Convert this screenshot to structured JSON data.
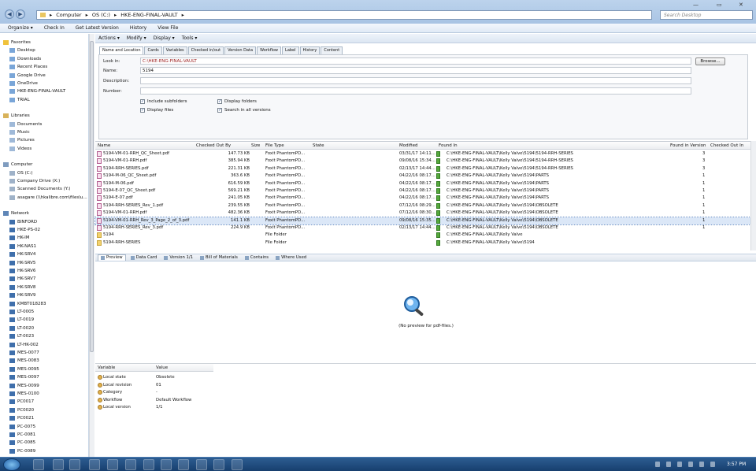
{
  "address": {
    "segments": [
      "Computer",
      "OS (C:)",
      "HKE-ENG-FINAL-VAULT"
    ],
    "search_placeholder": "Search Desktop"
  },
  "menubar": [
    "Organize ▾",
    "Check In",
    "Get Latest Version",
    "History",
    "View File"
  ],
  "sidebar": {
    "favorites_title": "Favorites",
    "favorites": [
      "Desktop",
      "Downloads",
      "Recent Places",
      "Google Drive",
      "OneDrive",
      "HKE-ENG-FINAL-VAULT",
      "TRIAL"
    ],
    "libraries_title": "Libraries",
    "libraries": [
      "Documents",
      "Music",
      "Pictures",
      "Videos"
    ],
    "computer_title": "Computer",
    "computer": [
      "OS (C:)",
      "Company Drive (X:)",
      "Scanned Documents (Y:)",
      "asagare (\\\\hkalibre.com\\files\\u..."
    ],
    "network_title": "Network",
    "network": [
      "BINFORD",
      "HKE-PS-02",
      "HK-IM",
      "HK-NAS1",
      "HK-SRV4",
      "HK-SRV5",
      "HK-SRV6",
      "HK-SRV7",
      "HK-SRV8",
      "HK-SRV9",
      "KMBT018283",
      "LT-0005",
      "LT-0019",
      "LT-0020",
      "LT-0023",
      "LT-HK-002",
      "MES-0077",
      "MES-0083",
      "MES-0095",
      "MES-0097",
      "MES-0099",
      "MES-0100",
      "PC0017",
      "PC0020",
      "PC0021",
      "PC-0075",
      "PC-0081",
      "PC-0085",
      "PC-0089"
    ]
  },
  "viewbar": [
    "Actions ▾",
    "Modify ▾",
    "Display ▾",
    "Tools ▾"
  ],
  "tabs": [
    "Name and Location",
    "Cards",
    "Variables",
    "Checked in/out",
    "Version Data",
    "Workflow",
    "Label",
    "History",
    "Content"
  ],
  "form": {
    "look_in_label": "Look in:",
    "look_in_value": "C:\\HKE-ENG-FINAL-VAULT",
    "name_label": "Name:",
    "name_value": "5194",
    "description_label": "Description:",
    "number_label": "Number:",
    "browse_label": "Browse...",
    "checkboxes": [
      "Include subfolders",
      "Display folders",
      "Display files",
      "Search in all versions"
    ]
  },
  "grid": {
    "headers": [
      "Name",
      "Checked Out By",
      "Size",
      "File Type",
      "State",
      "Modified",
      "Found In",
      "Found in Version",
      "Checked Out In"
    ],
    "rows": [
      {
        "name": "5194-VM-01-RRH_QC_Sheet.pdf",
        "size": "147.73 KB",
        "type": "Foxit PhantomPD...",
        "modified": "03/31/17 14:11...",
        "found": "C:\\HKE-ENG-FINAL-VAULT\\Kelly Valve\\5194\\5194-RRH-SERIES",
        "version": "3",
        "folder": false
      },
      {
        "name": "5194-VM-01-RRH.pdf",
        "size": "385.94 KB",
        "type": "Foxit PhantomPD...",
        "modified": "09/08/16 15:34...",
        "found": "C:\\HKE-ENG-FINAL-VAULT\\Kelly Valve\\5194\\5194-RRH-SERIES",
        "version": "3",
        "folder": false
      },
      {
        "name": "5194-RRH-SERIES.pdf",
        "size": "221.31 KB",
        "type": "Foxit PhantomPD...",
        "modified": "02/13/17 14:44...",
        "found": "C:\\HKE-ENG-FINAL-VAULT\\Kelly Valve\\5194\\5194-RRH-SERIES",
        "version": "3",
        "folder": false
      },
      {
        "name": "5194-M-06_QC_Sheet.pdf",
        "size": "363.6 KB",
        "type": "Foxit PhantomPD...",
        "modified": "04/22/16 08:17...",
        "found": "C:\\HKE-ENG-FINAL-VAULT\\Kelly Valve\\5194\\PARTS",
        "version": "1",
        "folder": false
      },
      {
        "name": "5194-M-06.pdf",
        "size": "616.59 KB",
        "type": "Foxit PhantomPD...",
        "modified": "04/22/16 08:17...",
        "found": "C:\\HKE-ENG-FINAL-VAULT\\Kelly Valve\\5194\\PARTS",
        "version": "1",
        "folder": false
      },
      {
        "name": "5194-E-07_QC_Sheet.pdf",
        "size": "569.21 KB",
        "type": "Foxit PhantomPD...",
        "modified": "04/22/16 08:17...",
        "found": "C:\\HKE-ENG-FINAL-VAULT\\Kelly Valve\\5194\\PARTS",
        "version": "1",
        "folder": false
      },
      {
        "name": "5194-E-07.pdf",
        "size": "241.05 KB",
        "type": "Foxit PhantomPD...",
        "modified": "04/22/16 08:17...",
        "found": "C:\\HKE-ENG-FINAL-VAULT\\Kelly Valve\\5194\\PARTS",
        "version": "1",
        "folder": false
      },
      {
        "name": "5194-RRH-SERIES_Rev_1.pdf",
        "size": "239.55 KB",
        "type": "Foxit PhantomPD...",
        "modified": "07/12/16 08:29...",
        "found": "C:\\HKE-ENG-FINAL-VAULT\\Kelly Valve\\5194\\OBSOLETE",
        "version": "1",
        "folder": false
      },
      {
        "name": "5194-VM-01-RRH.pdf",
        "size": "482.36 KB",
        "type": "Foxit PhantomPD...",
        "modified": "07/12/16 08:30...",
        "found": "C:\\HKE-ENG-FINAL-VAULT\\Kelly Valve\\5194\\OBSOLETE",
        "version": "1",
        "folder": false
      },
      {
        "name": "5194-VM-01-RRH_Rev_3_Page_2_of_3.pdf",
        "size": "141.1 KB",
        "type": "Foxit PhantomPD...",
        "modified": "09/08/16 15:35...",
        "found": "C:\\HKE-ENG-FINAL-VAULT\\Kelly Valve\\5194\\OBSOLETE",
        "version": "1",
        "folder": false,
        "selected": true
      },
      {
        "name": "5194-RRH-SERIES_Rev_3.pdf",
        "size": "224.9 KB",
        "type": "Foxit PhantomPD...",
        "modified": "02/13/17 14:44...",
        "found": "C:\\HKE-ENG-FINAL-VAULT\\Kelly Valve\\5194\\OBSOLETE",
        "version": "1",
        "folder": false
      },
      {
        "name": "5194",
        "size": "",
        "type": "File Folder",
        "modified": "",
        "found": "C:\\HKE-ENG-FINAL-VAULT\\Kelly Valve",
        "version": "",
        "folder": true
      },
      {
        "name": "5194-RRH-SERIES",
        "size": "",
        "type": "File Folder",
        "modified": "",
        "found": "C:\\HKE-ENG-FINAL-VAULT\\Kelly Valve\\5194",
        "version": "",
        "folder": true
      }
    ]
  },
  "preview_tabs": [
    "Preview",
    "Data Card",
    "Version 1/1",
    "Bill of Materials",
    "Contains",
    "Where Used"
  ],
  "preview_text": "(No preview for pdf-files.)",
  "props": {
    "headers": [
      "Variable",
      "Value"
    ],
    "rows": [
      {
        "var": "Local state",
        "val": "Obsolete"
      },
      {
        "var": "Local revision",
        "val": "01"
      },
      {
        "var": "Category",
        "val": "-"
      },
      {
        "var": "Workflow",
        "val": "Default Workflow"
      },
      {
        "var": "Local version",
        "val": "1/1"
      }
    ]
  },
  "taskbar": {
    "clock": "3:57 PM"
  }
}
